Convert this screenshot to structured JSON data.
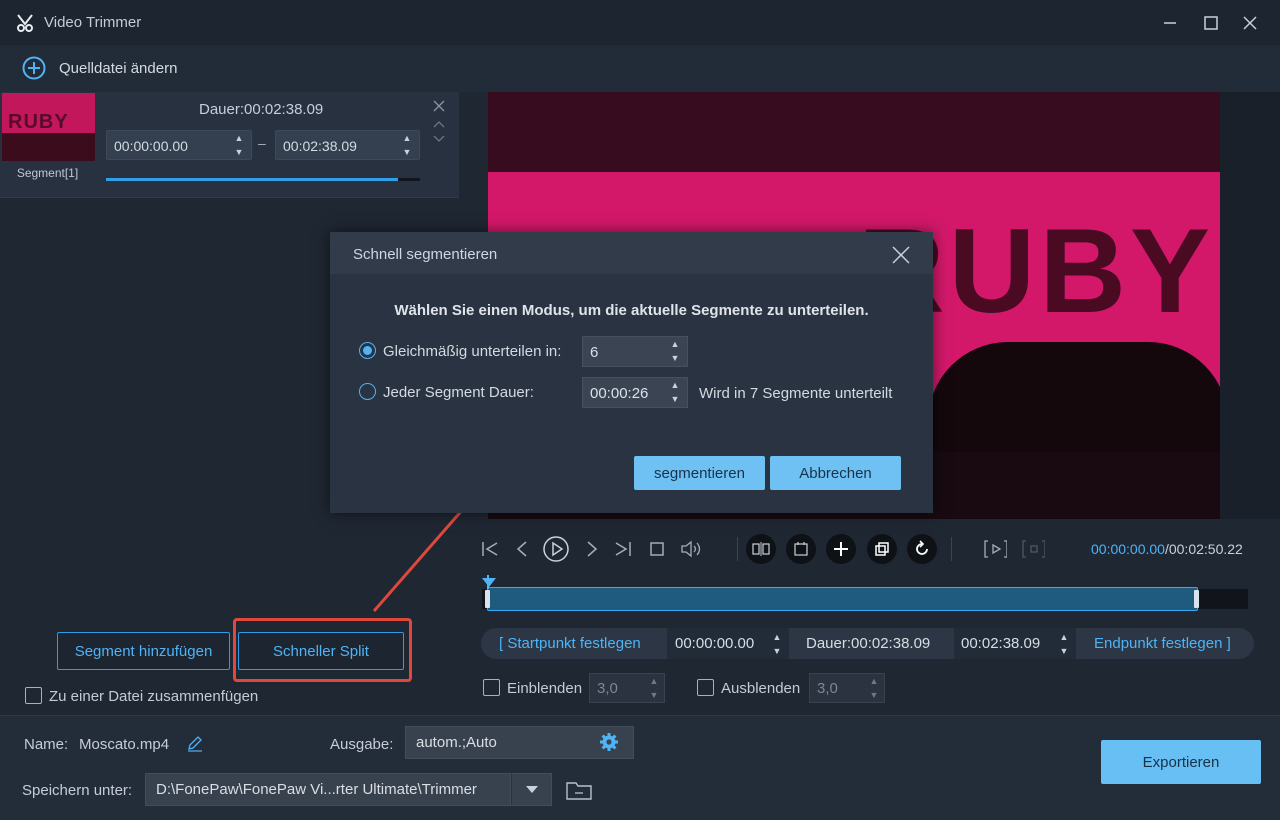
{
  "app": {
    "title": "Video Trimmer"
  },
  "toolbar": {
    "change_source_label": "Quelldatei ändern"
  },
  "segment": {
    "label": "Segment[1]",
    "duration": "Dauer:00:02:38.09",
    "start": "00:00:00.00",
    "end": "00:02:38.09",
    "progress": 0.93,
    "dash": "–",
    "thumb_text": "RUBY WOO"
  },
  "left_actions": {
    "add_segment": "Segment hinzufügen",
    "quick_split": "Schneller Split",
    "merge_label": "Zu einer Datei zusammenfügen"
  },
  "video": {
    "banner_text": "RUBY WOO"
  },
  "playback": {
    "current_time": "00:00:00.00",
    "total_time": "/00:02:50.22"
  },
  "range": {
    "set_start": "[ Startpunkt festlegen",
    "start_time": "00:00:00.00",
    "duration": "Dauer:00:02:38.09",
    "end_time": "00:02:38.09",
    "set_end": "Endpunkt festlegen ]"
  },
  "fade": {
    "fade_in_label": "Einblenden",
    "fade_in_value": "3,0",
    "fade_out_label": "Ausblenden",
    "fade_out_value": "3,0"
  },
  "bottom": {
    "name_label": "Name:",
    "name_value": "Moscato.mp4",
    "output_label": "Ausgabe:",
    "output_value": "autom.;Auto",
    "save_label": "Speichern unter:",
    "save_path": "D:\\FonePaw\\FonePaw Vi...rter Ultimate\\Trimmer",
    "export_label": "Exportieren"
  },
  "dialog": {
    "title": "Schnell segmentieren",
    "heading": "Wählen Sie einen Modus, um die aktuelle Segmente zu unterteilen.",
    "option_even_label": "Gleichmäßig unterteilen in:",
    "option_even_value": "6",
    "option_duration_label": "Jeder Segment Dauer:",
    "option_duration_value": "00:00:26",
    "result_text": "Wird in 7 Segmente unterteilt",
    "confirm_label": "segmentieren",
    "cancel_label": "Abbrechen"
  },
  "colors": {
    "accent": "#4fb3f6",
    "highlight": "#e0483d",
    "video": "#d3186a"
  }
}
